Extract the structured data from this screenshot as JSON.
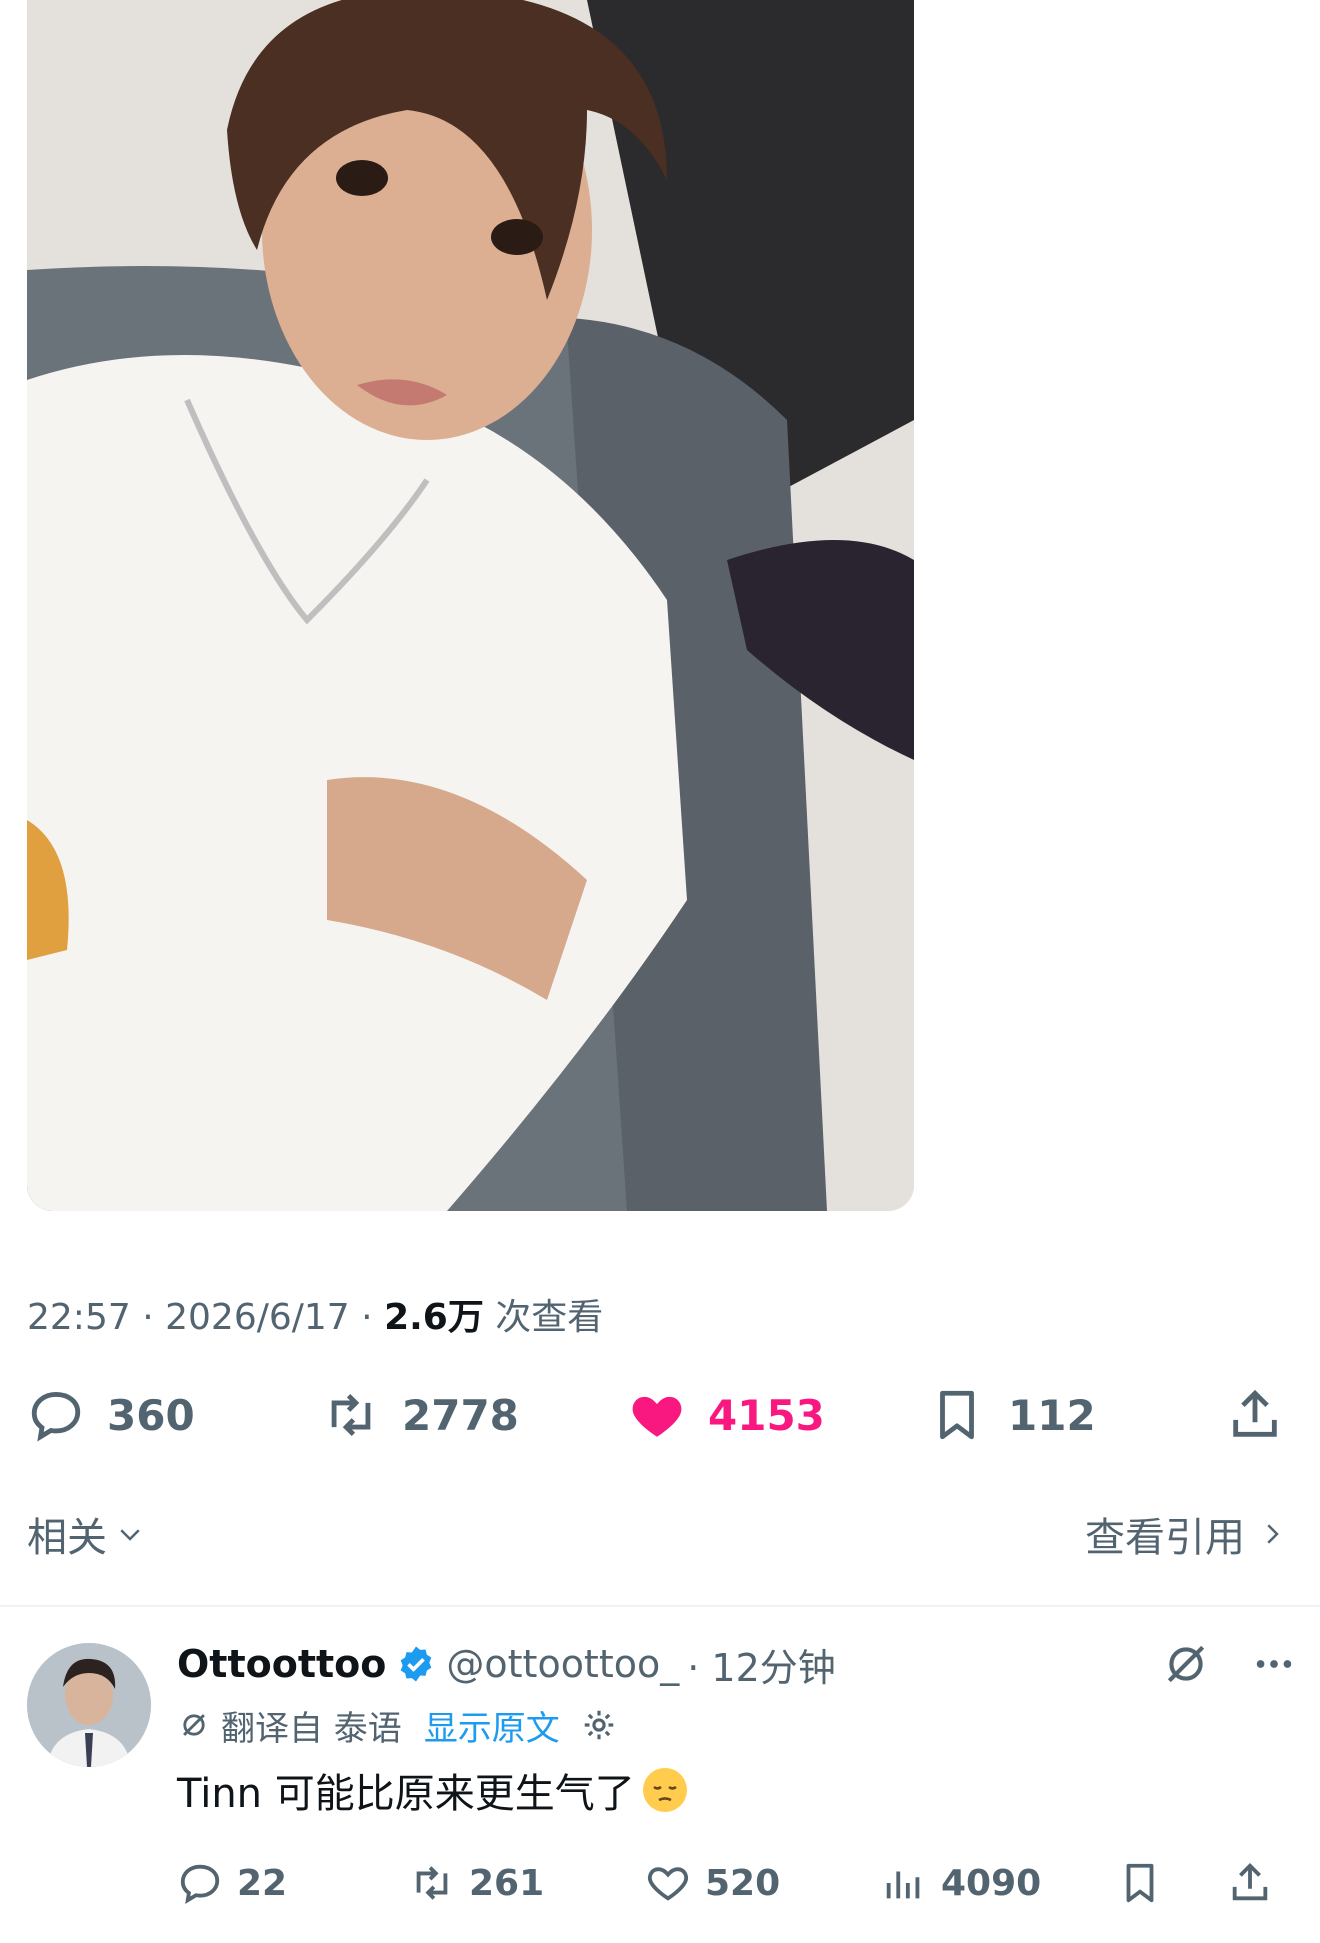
{
  "tweet": {
    "time": "22:57",
    "date": "2026/6/17",
    "views_count": "2.6万",
    "views_label": "次查看",
    "separator": "·",
    "stats": {
      "replies": "360",
      "retweets": "2778",
      "likes": "4153",
      "bookmarks": "112"
    }
  },
  "related_row": {
    "related_label": "相关",
    "quotes_label": "查看引用"
  },
  "reply": {
    "name": "Ottoottoo",
    "handle": "@ottoottoo_",
    "time": "· 12分钟",
    "translated_from": "翻译自 泰语",
    "show_original": "显示原文",
    "text": "Tinn 可能比原来更生气了",
    "stats": {
      "replies": "22",
      "retweets": "261",
      "likes": "520",
      "views": "4090"
    }
  },
  "colors": {
    "like_pink": "#f91880",
    "link_blue": "#1d9bf0",
    "muted_gray": "#536471",
    "text_dark": "#0f1419"
  },
  "icons": [
    "reply-icon",
    "retweet-icon",
    "heart-filled-icon",
    "bookmark-icon",
    "share-icon",
    "chevron-down-icon",
    "chevron-right-icon",
    "verified-badge-icon",
    "grok-icon",
    "more-icon",
    "translate-icon",
    "gear-icon",
    "pensive-emoji",
    "heart-outline-icon",
    "analytics-icon"
  ]
}
